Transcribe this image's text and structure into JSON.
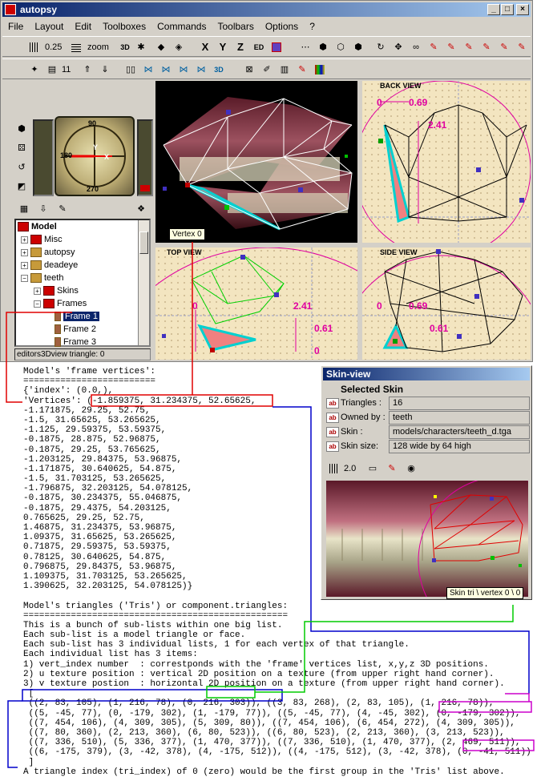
{
  "window": {
    "title": "autopsy"
  },
  "menu": [
    "File",
    "Layout",
    "Edit",
    "Toolboxes",
    "Commands",
    "Toolbars",
    "Options",
    "?"
  ],
  "toolbar": {
    "grid_value": "0.25",
    "zoom_label": "zoom",
    "axes": [
      "X",
      "Y",
      "Z"
    ],
    "frame_count": "11"
  },
  "compass": {
    "n": "90",
    "w": "180",
    "s": "270",
    "y": "Y",
    "x": "X"
  },
  "views": {
    "view3d_tooltip": "Vertex 0",
    "back_label": "BACK VIEW",
    "top_label": "TOP VIEW",
    "side_label": "SIDE VIEW",
    "back_dims": {
      "w": "0.69",
      "h": "2.41",
      "o": "0"
    },
    "top_dims": {
      "h": "2.41",
      "w": "0.61",
      "o": "0"
    },
    "side_dims": {
      "w": "0.69",
      "h": "0.61",
      "o": "0"
    }
  },
  "tree": {
    "root": "Model",
    "items": [
      "Misc",
      "autopsy",
      "deadeye",
      "teeth",
      "Skins",
      "Frames",
      "Frame 1",
      "Frame 2",
      "Frame 3"
    ]
  },
  "status_text": "editors3Dview triangle: 0",
  "skin_view": {
    "title": "Skin-view",
    "heading": "Selected Skin",
    "props": [
      {
        "label": "Triangles :",
        "value": "16"
      },
      {
        "label": "Owned by :",
        "value": "teeth"
      },
      {
        "label": "Skin :",
        "value": "models/characters/teeth_d.tga"
      },
      {
        "label": "Skin size:",
        "value": "128 wide by 64 high"
      }
    ],
    "zoom": "2.0",
    "tooltip": "Skin tri \\ vertex 0 \\ 0"
  },
  "code_lines": [
    "Model's 'frame vertices':",
    "=========================",
    "{'index': (0.0,),",
    "'Vertices': (-1.859375, 31.234375, 52.65625,",
    "-1.171875, 29.25, 52.75,",
    "-1.5, 31.65625, 53.265625,",
    "-1.125, 29.59375, 53.59375,",
    "-0.1875, 28.875, 52.96875,",
    "-0.1875, 29.25, 53.765625,",
    "-1.203125, 29.84375, 53.96875,",
    "-1.171875, 30.640625, 54.875,",
    "-1.5, 31.703125, 53.265625,",
    "-1.796875, 32.203125, 54.078125,",
    "-0.1875, 30.234375, 55.046875,",
    "-0.1875, 29.4375, 54.203125,",
    "0.765625, 29.25, 52.75,",
    "1.46875, 31.234375, 53.96875,",
    "1.09375, 31.65625, 53.265625,",
    "0.71875, 29.59375, 53.59375,",
    "0.78125, 30.640625, 54.875,",
    "0.796875, 29.84375, 53.96875,",
    "1.109375, 31.703125, 53.265625,",
    "1.390625, 32.203125, 54.078125)}",
    "",
    "Model's triangles ('Tris') or component.triangles:",
    "==================================================",
    "This is a bunch of sub-lists within one big list.",
    "Each sub-list is a model triangle or face.",
    "Each sub-list has 3 individual lists, 1 for each vertex of that triangle.",
    "Each individual list has 3 items:",
    "1) vert_index number  : correstponds with the 'frame' vertices list, x,y,z 3D positions.",
    "2) u texture position : vertical 2D position on a texture (from upper right hand corner).",
    "3) v texture postion  : horizontal 2D position on a texture (from upper right hand corner).",
    " [",
    " ((2, 83, 105), (1, 216, 78), (0, 216, 303)), ((3, 83, 268), (2, 83, 105), (1, 216, 78)),",
    " ((5, -45, 77), (0, -179, 302), (1, -179, 77)), ((5, -45, 77), (4, -45, 302), (0, -179, 302)),",
    " ((7, 454, 106), (4, 309, 305), (5, 309, 80)), ((7, 454, 106), (6, 454, 272), (4, 309, 305)),",
    " ((7, 80, 360), (2, 213, 360), (6, 80, 523)), ((6, 80, 523), (2, 213, 360), (3, 213, 523)),",
    " ((7, 336, 510), (5, 336, 377), (1, 470, 377)), ((7, 336, 510), (1, 470, 377), (2, 469, 511)),",
    " ((6, -175, 379), (3, -42, 378), (4, -175, 512)), ((4, -175, 512), (3, -42, 378), (0, -41, 511))",
    " ]",
    "A triangle index (tri_index) of 0 (zero) would be the first group in the 'Tris' list above."
  ],
  "colors": {
    "accent_red": "#e00000",
    "accent_blue": "#0000cc",
    "accent_green": "#00cc00",
    "accent_magenta": "#cc00cc"
  }
}
